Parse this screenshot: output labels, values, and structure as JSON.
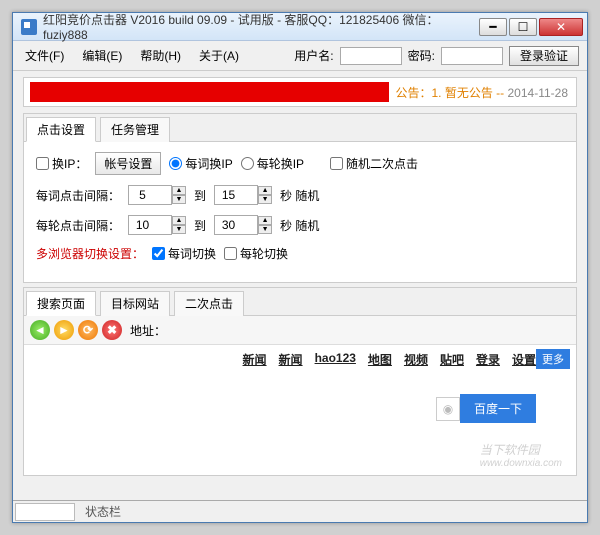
{
  "title": "红阳竞价点击器 V2016 build 09.09 - 试用版 - 客服QQ：121825406 微信：fuziy888",
  "menu": {
    "file": "文件(F)",
    "edit": "编辑(E)",
    "help": "帮助(H)",
    "about": "关于(A)"
  },
  "login": {
    "user_label": "用户名:",
    "pass_label": "密码:",
    "user_value": "",
    "pass_value": "",
    "login_btn": "登录验证"
  },
  "notice": {
    "prefix": "公告：",
    "text": "1. 暂无公告 -- ",
    "date": "2014-11-28"
  },
  "tabs1": {
    "click_settings": "点击设置",
    "task_mgr": "任务管理"
  },
  "settings": {
    "change_ip": "换IP：",
    "account_btn": "帐号设置",
    "per_word_ip": "每词换IP",
    "per_round_ip": "每轮换IP",
    "random_second_click": "随机二次点击",
    "word_interval_label": "每词点击间隔：",
    "round_interval_label": "每轮点击间隔：",
    "to": "到",
    "sec_random": "秒  随机",
    "word_min": 5,
    "word_max": 15,
    "round_min": 10,
    "round_max": 30,
    "multi_browser_label": "多浏览器切换设置：",
    "word_switch": "每词切换",
    "round_switch": "每轮切换"
  },
  "tabs2": {
    "search_page": "搜索页面",
    "target_site": "目标网站",
    "second_click": "二次点击"
  },
  "addrbar": {
    "label": "地址："
  },
  "web": {
    "links": [
      "新闻",
      "新闻",
      "hao123",
      "地图",
      "视频",
      "贴吧",
      "登录",
      "设置"
    ],
    "more": "更多",
    "search_btn": "百度一下"
  },
  "status": {
    "label": "状态栏"
  },
  "watermark": {
    "line1": "当下软件园",
    "line2": "www.downxia.com"
  }
}
